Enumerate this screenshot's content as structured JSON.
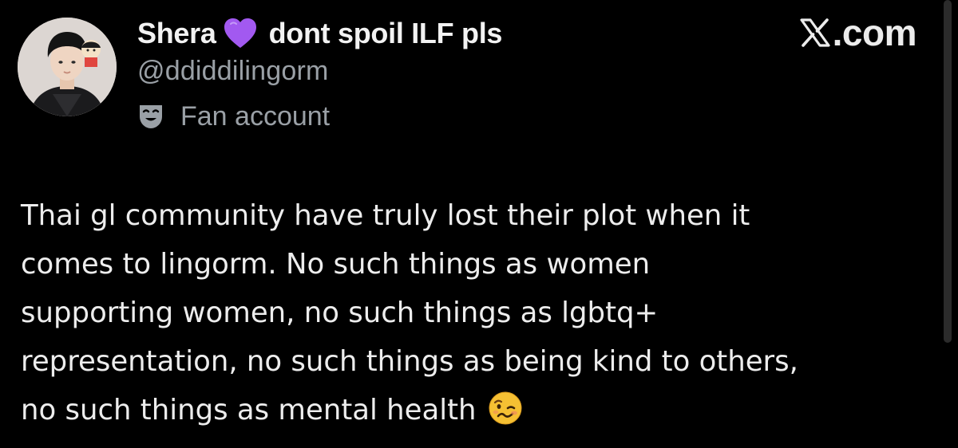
{
  "author": {
    "display_name": "Shera",
    "name_emoji": "purple-heart-icon",
    "name_suffix": "dont spoil ILF pls",
    "handle": "@ddiddilingorm",
    "label_icon": "theater-mask-icon",
    "label": "Fan account"
  },
  "brand": {
    "text": ".com",
    "logo": "x-logo-icon"
  },
  "tweet": {
    "lines": [
      "Thai gl community have truly lost their plot when it",
      "comes to lingorm. No such things as women",
      "supporting women, no such things as lgbtq+",
      "representation, no such things as being kind to others,",
      "no such things as mental health"
    ],
    "trailing_emoji": "woozy-face-icon"
  },
  "colors": {
    "background": "#000000",
    "text": "#e7e9ea",
    "secondary": "#9aa0a6",
    "heart": "#a259f0",
    "emoji": "#f5c033"
  }
}
